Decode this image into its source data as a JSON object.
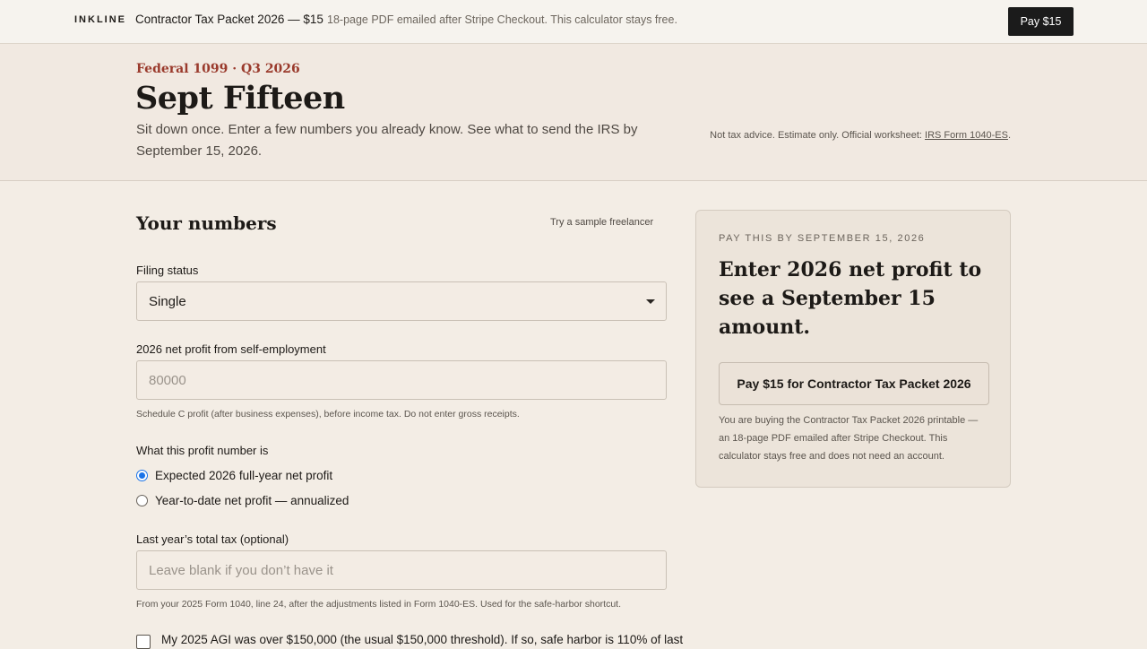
{
  "topbar": {
    "brand": "INKLINE",
    "product": "Contractor Tax Packet 2026 — $15",
    "note": "18-page PDF emailed after Stripe Checkout. This calculator stays free.",
    "pay_label": "Pay $15"
  },
  "hero": {
    "eyebrow": "Federal 1099 · Q3 2026",
    "title": "Sept Fifteen",
    "subtitle": "Sit down once. Enter a few numbers you already know. See what to send the IRS by September 15, 2026.",
    "disclaimer_prefix": "Not tax advice. Estimate only. Official worksheet: ",
    "disclaimer_link": "IRS Form 1040-ES",
    "disclaimer_suffix": "."
  },
  "form": {
    "section_title": "Your numbers",
    "sample_link": "Try a sample freelancer",
    "filing_status": {
      "label": "Filing status",
      "value": "Single"
    },
    "net_profit": {
      "label": "2026 net profit from self-employment",
      "placeholder": "80000",
      "help": "Schedule C profit (after business expenses), before income tax. Do not enter gross receipts."
    },
    "profit_type": {
      "label": "What this profit number is",
      "options": [
        {
          "label": "Expected 2026 full-year net profit",
          "selected": true
        },
        {
          "label": "Year-to-date net profit — annualized",
          "selected": false
        }
      ]
    },
    "last_year_tax": {
      "label": "Last year’s total tax (optional)",
      "placeholder": "Leave blank if you don’t have it",
      "help": "From your 2025 Form 1040, line 24, after the adjustments listed in Form 1040-ES. Used for the safe-harbor shortcut."
    },
    "agi_checkbox": {
      "label": "My 2025 AGI was over $150,000 (the usual $150,000 threshold). If so, safe harbor is 110% of last",
      "checked": false
    }
  },
  "card": {
    "eyebrow": "PAY THIS BY SEPTEMBER 15, 2026",
    "title": "Enter 2026 net profit to see a September 15 amount.",
    "button": "Pay $15 for Contractor Tax Packet 2026",
    "note": "You are buying the Contractor Tax Packet 2026 printable — an 18-page PDF emailed after Stripe Checkout. This calculator stays free and does not need an account."
  }
}
